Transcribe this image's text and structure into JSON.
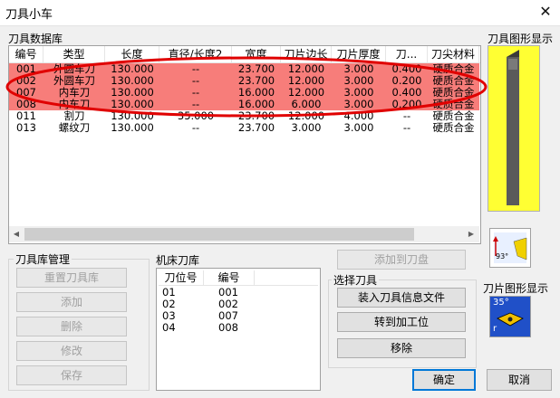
{
  "window": {
    "title": "刀具小车",
    "close_glyph": "✕"
  },
  "tool_db": {
    "label": "刀具数据库",
    "columns": [
      "编号",
      "类型",
      "长度",
      "直径/长度2",
      "宽度",
      "刀片边长",
      "刀片厚度",
      "刀...",
      "刀尖材料"
    ],
    "rows": [
      {
        "id": "001",
        "type": "外圆车刀",
        "length": "130.000",
        "diam": "--",
        "width": "23.700",
        "edge": "12.000",
        "thick": "3.000",
        "tip": "0.400",
        "mat": "硬质合金",
        "highlight": true
      },
      {
        "id": "002",
        "type": "外圆车刀",
        "length": "130.000",
        "diam": "--",
        "width": "23.700",
        "edge": "12.000",
        "thick": "3.000",
        "tip": "0.200",
        "mat": "硬质合金",
        "highlight": true
      },
      {
        "id": "007",
        "type": "内车刀",
        "length": "130.000",
        "diam": "--",
        "width": "16.000",
        "edge": "12.000",
        "thick": "3.000",
        "tip": "0.400",
        "mat": "硬质合金",
        "highlight": true
      },
      {
        "id": "008",
        "type": "内车刀",
        "length": "130.000",
        "diam": "--",
        "width": "16.000",
        "edge": "6.000",
        "thick": "3.000",
        "tip": "0.200",
        "mat": "硬质合金",
        "highlight": true
      },
      {
        "id": "011",
        "type": "割刀",
        "length": "130.000",
        "diam": "35.000",
        "width": "23.700",
        "edge": "12.000",
        "thick": "4.000",
        "tip": "--",
        "mat": "硬质合金",
        "highlight": false
      },
      {
        "id": "013",
        "type": "螺纹刀",
        "length": "130.000",
        "diam": "--",
        "width": "23.700",
        "edge": "3.000",
        "thick": "3.000",
        "tip": "--",
        "mat": "硬质合金",
        "highlight": false
      }
    ]
  },
  "tool_graphic": {
    "label": "刀具图形显示",
    "angle_text": "93°"
  },
  "insert_graphic": {
    "label": "刀片图形显示",
    "angle_text": "35°",
    "r_text": "r"
  },
  "library_mgmt": {
    "label": "刀具库管理",
    "buttons": [
      "重置刀具库",
      "添加",
      "删除",
      "修改",
      "保存"
    ]
  },
  "machine_lib": {
    "label": "机床刀库",
    "columns": [
      "刀位号",
      "编号"
    ],
    "rows": [
      {
        "pos": "01",
        "id": "001"
      },
      {
        "pos": "02",
        "id": "002"
      },
      {
        "pos": "03",
        "id": "007"
      },
      {
        "pos": "04",
        "id": "008"
      }
    ]
  },
  "add_to_disk_button": "添加到刀盘",
  "select_tool": {
    "label": "选择刀具",
    "buttons": [
      "装入刀具信息文件",
      "转到加工位",
      "移除"
    ]
  },
  "ok_button": "确定",
  "cancel_button": "取消",
  "colors": {
    "highlight": "#f77d7a",
    "annotation": "#e00000",
    "tool_bg": "#ffff33",
    "accent": "#0078d7"
  }
}
